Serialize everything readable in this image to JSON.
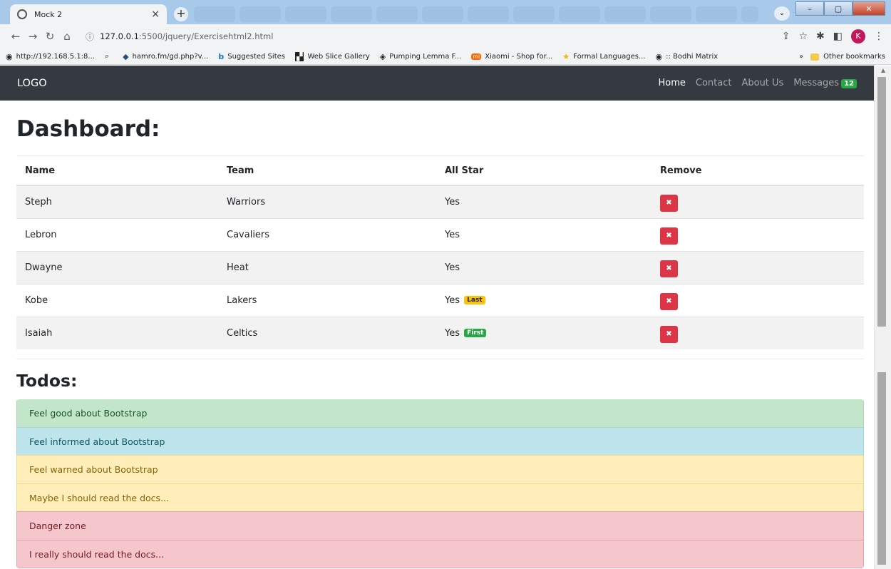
{
  "browser": {
    "tab_title": "Mock 2",
    "url_host": "127.0.0.1",
    "url_rest": ":5500/jquery/Exercisehtml2.html",
    "profile_initial": "K",
    "bookmarks": [
      {
        "icon": "globe-icon",
        "label": "http://192.168.5.1:8..."
      },
      {
        "icon": "search-icon",
        "label": ""
      },
      {
        "icon": "diamond-icon",
        "label": "hamro.fm/gd.php?v..."
      },
      {
        "icon": "bing-icon",
        "label": "Suggested Sites"
      },
      {
        "icon": "web-slice-icon",
        "label": "Web Slice Gallery"
      },
      {
        "icon": "pumping-icon",
        "label": "Pumping Lemma F..."
      },
      {
        "icon": "mi-icon",
        "label": "Xiaomi - Shop for..."
      },
      {
        "icon": "star-icon",
        "label": "Formal Languages..."
      },
      {
        "icon": "globe-icon",
        "label": ":: Bodhi Matrix"
      }
    ],
    "other_bookmarks": "Other bookmarks"
  },
  "navbar": {
    "brand": "LOGO",
    "links": [
      "Home",
      "Contact",
      "About Us",
      "Messages"
    ],
    "messages_count": "12"
  },
  "dashboard": {
    "title": "Dashboard:",
    "headers": [
      "Name",
      "Team",
      "All Star",
      "Remove"
    ],
    "rows": [
      {
        "name": "Steph",
        "team": "Warriors",
        "all_star": "Yes",
        "tag": ""
      },
      {
        "name": "Lebron",
        "team": "Cavaliers",
        "all_star": "Yes",
        "tag": ""
      },
      {
        "name": "Dwayne",
        "team": "Heat",
        "all_star": "Yes",
        "tag": ""
      },
      {
        "name": "Kobe",
        "team": "Lakers",
        "all_star": "Yes",
        "tag": "Last"
      },
      {
        "name": "Isaiah",
        "team": "Celtics",
        "all_star": "Yes",
        "tag": "First"
      }
    ],
    "remove_symbol": "✖"
  },
  "todos": {
    "title": "Todos:",
    "items": [
      "Feel good about Bootstrap",
      "Feel informed about Bootstrap",
      "Feel warned about Bootstrap",
      "Maybe I should read the docs...",
      "Danger zone",
      "I really should read the docs..."
    ]
  },
  "colors": {
    "navbar": "#343a40",
    "danger": "#dc3545",
    "success": "#28a745",
    "warning": "#ffc107"
  }
}
